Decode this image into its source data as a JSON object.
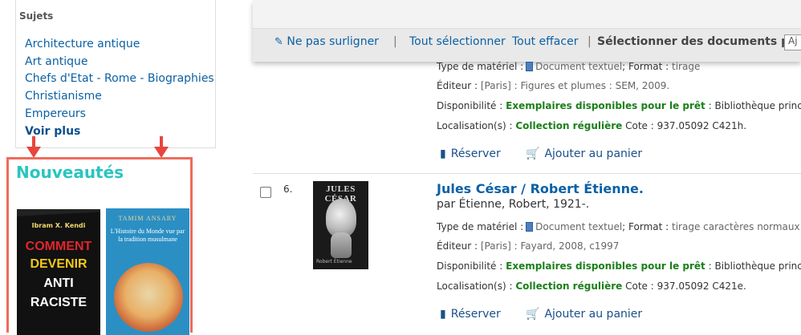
{
  "facets": {
    "heading": "Sujets",
    "items": [
      "Architecture antique",
      "Art antique",
      "Chefs d'Etat - Rome - Biographies",
      "Christianisme",
      "Empereurs"
    ],
    "more": "Voir plus"
  },
  "news": {
    "title": "Nouveautés",
    "book1": {
      "author": "Ibram X. Kendi",
      "lines": [
        "COMMENT",
        "DEVENIR",
        "ANTI",
        "RACISTE"
      ]
    },
    "book2": {
      "author": "TAMIM ANSARY",
      "title": "L'Histoire du Monde vue par la tradition musulmane"
    }
  },
  "toolbar": {
    "no_highlight": "Ne pas surligner",
    "sep": "|",
    "select_all": "Tout sélectionner",
    "clear_all": "Tout effacer",
    "select_for": "Sélectionner des documents pour :",
    "select_value": "Aj"
  },
  "result_prev": {
    "type_label": "Type de matériel :",
    "type_value": "Document textuel",
    "format_label": "; Format :",
    "format_value": "tirage",
    "publisher_label": "Éditeur :",
    "publisher_value": "[Paris] : Figures et plumes : SEM, 2009.",
    "avail_label": "Disponibilité :",
    "avail_value": "Exemplaires disponibles pour le prêt",
    "avail_rest": ": Bibliothèque principale (",
    "loc_label": "Localisation(s) :",
    "loc_value": "Collection régulière",
    "cote": "Cote : 937.05092 C421h.",
    "reserve": "Réserver",
    "cart": "Ajouter au panier"
  },
  "result6": {
    "number": "6.",
    "thumb_title": "JULES CÉSAR",
    "thumb_author": "Robert Étienne",
    "title": "Jules César / Robert Étienne.",
    "author": "par Étienne, Robert, 1921-.",
    "type_label": "Type de matériel :",
    "type_value": "Document textuel",
    "format_label": "; Format :",
    "format_value": "tirage caractères normaux ; Na",
    "publisher_label": "Éditeur :",
    "publisher_value": "[Paris] : Fayard, 2008, c1997",
    "avail_label": "Disponibilité :",
    "avail_value": "Exemplaires disponibles pour le prêt",
    "avail_rest": ": Bibliothèque principale (",
    "loc_label": "Localisation(s) :",
    "loc_value": "Collection régulière",
    "cote": "Cote : 937.05092 C421e.",
    "reserve": "Réserver",
    "cart": "Ajouter au panier"
  },
  "colors": {
    "accent": "#0b61a4",
    "news_title": "#29c5c0",
    "news_border": "#ef6b5b",
    "arrow": "#e8453c",
    "available": "#1a7f1a"
  }
}
